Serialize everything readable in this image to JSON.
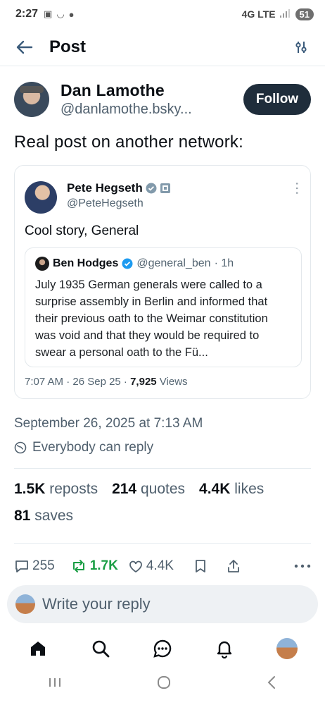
{
  "status_bar": {
    "time": "2:27",
    "network": "4G LTE",
    "battery": "51"
  },
  "header": {
    "title": "Post"
  },
  "author": {
    "display_name": "Dan Lamothe",
    "handle": "@danlamothe.bsky...",
    "follow_label": "Follow"
  },
  "post": {
    "text": "Real post on another network:"
  },
  "quoted": {
    "display_name": "Pete Hegseth",
    "handle": "@PeteHegseth",
    "text": "Cool story, General",
    "nested": {
      "display_name": "Ben Hodges",
      "handle": "@general_ben",
      "age": "· 1h",
      "text": "July 1935 German generals were called to a surprise assembly in Berlin and informed that their previous oath to the Weimar constitution was void and that they would be required to swear a personal oath to the Fü..."
    },
    "footer_time": "7:07 AM · 26 Sep 25 · ",
    "footer_views_count": "7,925",
    "footer_views_label": " Views"
  },
  "meta": {
    "date": "September 26, 2025 at 7:13 AM",
    "reply_setting": "Everybody can reply"
  },
  "stats": {
    "reposts_count": "1.5K",
    "reposts_label": "reposts",
    "quotes_count": "214",
    "quotes_label": "quotes",
    "likes_count": "4.4K",
    "likes_label": "likes",
    "saves_count": "81",
    "saves_label": "saves"
  },
  "actions": {
    "replies": "255",
    "reposts": "1.7K",
    "likes": "4.4K"
  },
  "reply_box": {
    "placeholder": "Write your reply"
  },
  "colors": {
    "accent": "#1f2d3b",
    "repost_green": "#1b9e45",
    "verified_blue": "#1d9bf0",
    "muted": "#50606e"
  }
}
